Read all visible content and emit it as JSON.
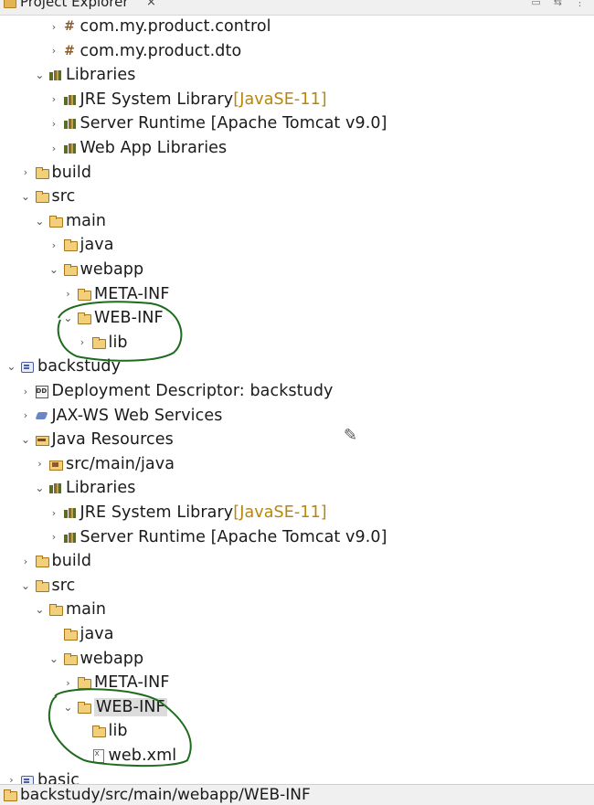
{
  "view": {
    "title": "Project Explorer",
    "close_glyph": "×",
    "icon": "folder-icon"
  },
  "tree": [
    {
      "label": "com.my.product.control",
      "indent": 3,
      "toggle": "collapsed",
      "icon": "package"
    },
    {
      "label": "com.my.product.dto",
      "indent": 3,
      "toggle": "collapsed",
      "icon": "package"
    },
    {
      "label": "Libraries",
      "indent": 2,
      "toggle": "expanded",
      "icon": "library"
    },
    {
      "label": "JRE System Library",
      "decoration": "[JavaSE-11]",
      "indent": 3,
      "toggle": "collapsed",
      "icon": "library"
    },
    {
      "label": "Server Runtime [Apache Tomcat v9.0]",
      "indent": 3,
      "toggle": "collapsed",
      "icon": "library"
    },
    {
      "label": "Web App Libraries",
      "indent": 3,
      "toggle": "collapsed",
      "icon": "library"
    },
    {
      "label": "build",
      "indent": 1,
      "toggle": "collapsed",
      "icon": "folder"
    },
    {
      "label": "src",
      "indent": 1,
      "toggle": "expanded",
      "icon": "folder"
    },
    {
      "label": "main",
      "indent": 2,
      "toggle": "expanded",
      "icon": "folder"
    },
    {
      "label": "java",
      "indent": 3,
      "toggle": "collapsed",
      "icon": "folder"
    },
    {
      "label": "webapp",
      "indent": 3,
      "toggle": "expanded",
      "icon": "folder"
    },
    {
      "label": "META-INF",
      "indent": 4,
      "toggle": "collapsed",
      "icon": "folder"
    },
    {
      "label": "WEB-INF",
      "indent": 4,
      "toggle": "expanded",
      "icon": "folder"
    },
    {
      "label": "lib",
      "indent": 5,
      "toggle": "collapsed",
      "icon": "folder"
    },
    {
      "label": "backstudy",
      "indent": 0,
      "toggle": "expanded",
      "icon": "project"
    },
    {
      "label": "Deployment Descriptor: backstudy",
      "indent": 1,
      "toggle": "collapsed",
      "icon": "deploy"
    },
    {
      "label": "JAX-WS Web Services",
      "indent": 1,
      "toggle": "collapsed",
      "icon": "webservice"
    },
    {
      "label": "Java Resources",
      "indent": 1,
      "toggle": "expanded",
      "icon": "javares"
    },
    {
      "label": "src/main/java",
      "indent": 2,
      "toggle": "collapsed",
      "icon": "srcfolder"
    },
    {
      "label": "Libraries",
      "indent": 2,
      "toggle": "expanded",
      "icon": "library"
    },
    {
      "label": "JRE System Library",
      "decoration": "[JavaSE-11]",
      "indent": 3,
      "toggle": "collapsed",
      "icon": "library"
    },
    {
      "label": "Server Runtime [Apache Tomcat v9.0]",
      "indent": 3,
      "toggle": "collapsed",
      "icon": "library"
    },
    {
      "label": "build",
      "indent": 1,
      "toggle": "collapsed",
      "icon": "folder"
    },
    {
      "label": "src",
      "indent": 1,
      "toggle": "expanded",
      "icon": "folder"
    },
    {
      "label": "main",
      "indent": 2,
      "toggle": "expanded",
      "icon": "folder"
    },
    {
      "label": "java",
      "indent": 3,
      "toggle": "none",
      "icon": "folder"
    },
    {
      "label": "webapp",
      "indent": 3,
      "toggle": "expanded",
      "icon": "folder"
    },
    {
      "label": "META-INF",
      "indent": 4,
      "toggle": "collapsed",
      "icon": "folder"
    },
    {
      "label": "WEB-INF",
      "indent": 4,
      "toggle": "expanded",
      "icon": "folder",
      "selected": true
    },
    {
      "label": "lib",
      "indent": 5,
      "toggle": "none",
      "icon": "folder"
    },
    {
      "label": "web.xml",
      "indent": 5,
      "toggle": "none",
      "icon": "xmlfile"
    },
    {
      "label": "basic",
      "indent": 0,
      "toggle": "collapsed",
      "icon": "project"
    }
  ],
  "status_bar": {
    "path": "backstudy/src/main/webapp/WEB-INF",
    "icon": "folder-icon"
  },
  "annotation_color": "#1e6b1e"
}
